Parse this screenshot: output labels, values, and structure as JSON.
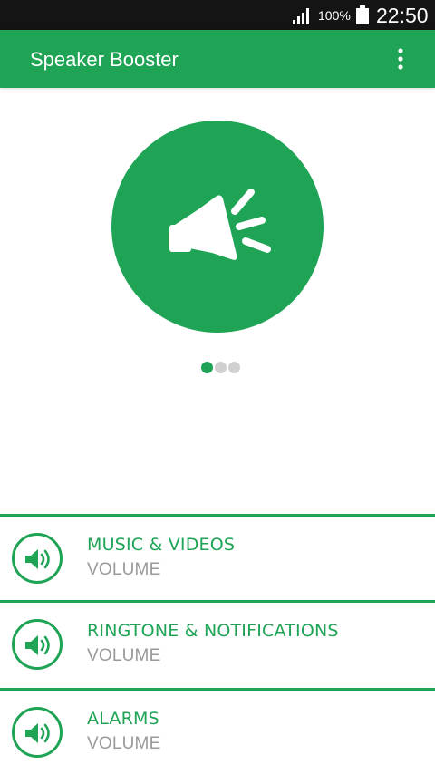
{
  "status_bar": {
    "battery_percent": "100%",
    "clock": "22:50",
    "icons": [
      "signal-icon",
      "battery-icon"
    ]
  },
  "app_bar": {
    "title": "Speaker Booster",
    "menu_icon": "overflow-menu-icon"
  },
  "hero": {
    "icon": "megaphone-icon"
  },
  "pager": {
    "count": 3,
    "active_index": 0
  },
  "volume_cards": [
    {
      "title": "MUSIC & VIDEOS",
      "subtitle": "VOLUME",
      "icon": "speaker-icon"
    },
    {
      "title": "RINGTONE & NOTIFICATIONS",
      "subtitle": "VOLUME",
      "icon": "speaker-icon"
    },
    {
      "title": "ALARMS",
      "subtitle": "VOLUME",
      "icon": "speaker-icon"
    }
  ],
  "colors": {
    "accent": "#1FA456",
    "status_bar": "#141414",
    "subtitle": "#9a9a9a",
    "dot_inactive": "#d0d0d0"
  }
}
